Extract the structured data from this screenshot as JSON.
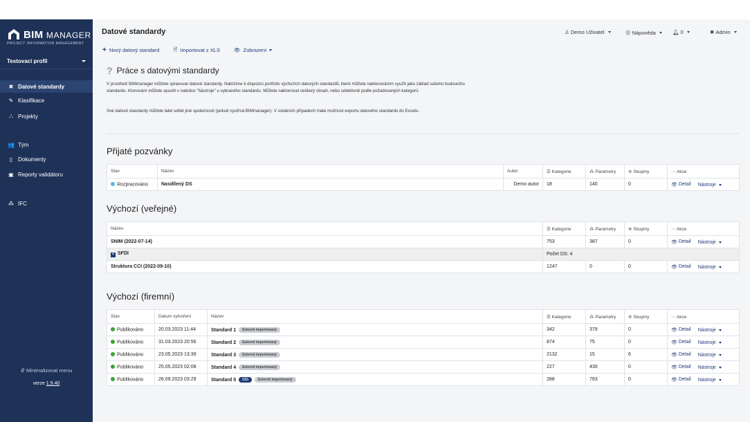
{
  "sidebar": {
    "logo_bold": "BIM",
    "logo_thin": "MANAGER",
    "logo_sub": "PROJECT INFORMATION MANAGEMENT",
    "profile": "Testovací profil",
    "items": [
      {
        "label": "Datové standardy",
        "icon": "tools-icon"
      },
      {
        "label": "Klasifikace",
        "icon": "pen-icon"
      },
      {
        "label": "Projekty",
        "icon": "sitemap-icon"
      },
      {
        "label": "Tým",
        "icon": "users-icon"
      },
      {
        "label": "Dokumenty",
        "icon": "document-icon"
      },
      {
        "label": "Reporty validátoru",
        "icon": "clipboard-icon"
      },
      {
        "label": "IFC",
        "icon": "shapes-icon"
      }
    ],
    "minimize": "Minimalizovat menu",
    "version_label": "verze",
    "version": "1.9.40"
  },
  "header": {
    "title": "Datové standardy",
    "user": "Demo Uživatel",
    "help": "Nápověda",
    "notifications": "0",
    "admin": "Admin"
  },
  "toolbar": {
    "new": "Nový datový standard",
    "import": "Importovat z XLS",
    "view": "Zobrazení"
  },
  "help": {
    "title": "Práce s datovými standardy",
    "p1": "V prostředí BIMmanager můžete spravovat datové standardy. Nabízíme k dispozici portfolio výchozích datových standardů, které můžete naklonováním využít jako základ vašeho budoucího standardu. Klonování můžete spustit v nabídce \"Nástroje\" u vybraného standardu. Můžete naklonovat veškerý obsah, nebo selektivně podle požadovaných kategorií.",
    "p2": "Své datové standardy můžete také sdílet jiné společnosti (pokud využívá BIMmanager). V ostatních případech máte možnost exportu datového standardu do Excelu."
  },
  "invites": {
    "title": "Přijaté pozvánky",
    "headers": {
      "stav": "Stav",
      "nazev": "Název",
      "autor": "Autor",
      "kategorie": "Kategorie",
      "parametry": "Parametry",
      "skupiny": "Skupiny",
      "akce": "Akce"
    },
    "rows": [
      {
        "stav": "Rozpracováno",
        "nazev": "Nasdílený DS",
        "autor": "Demo autor",
        "kategorie": "18",
        "parametry": "140",
        "skupiny": "0"
      }
    ]
  },
  "public": {
    "title": "Výchozí (veřejné)",
    "headers": {
      "nazev": "Název",
      "kategorie": "Kategorie",
      "parametry": "Parametry",
      "skupiny": "Skupiny",
      "akce": "Akce"
    },
    "rows": [
      {
        "nazev": "SNIM (2022-07-14)",
        "kategorie": "753",
        "parametry": "387",
        "skupiny": "0"
      },
      {
        "nazev": "SFDI",
        "count_label": "Počet DS: 4"
      },
      {
        "nazev": "Struktura CCI (2022-09-10)",
        "kategorie": "1247",
        "parametry": "0",
        "skupiny": "0"
      }
    ]
  },
  "company": {
    "title": "Výchozí (firemní)",
    "headers": {
      "stav": "Stav",
      "datum": "Datum vytvoření",
      "nazev": "Název",
      "kategorie": "Kategorie",
      "parametry": "Parametry",
      "skupiny": "Skupiny",
      "akce": "Akce"
    },
    "badge_ext": "Externě importovaný",
    "badge_cci": "CCI",
    "rows": [
      {
        "stav": "Publikováno",
        "datum": "20.03.2023 11:44",
        "nazev": "Standard 1",
        "kategorie": "342",
        "parametry": "379",
        "skupiny": "0"
      },
      {
        "stav": "Publikováno",
        "datum": "31.03.2023 20:56",
        "nazev": "Standard 2",
        "kategorie": "874",
        "parametry": "75",
        "skupiny": "0"
      },
      {
        "stav": "Publikováno",
        "datum": "23.05.2023 13:39",
        "nazev": "Standard 3",
        "kategorie": "2132",
        "parametry": "15",
        "skupiny": "6"
      },
      {
        "stav": "Publikováno",
        "datum": "25.05.2023 02:08",
        "nazev": "Standard 4",
        "kategorie": "227",
        "parametry": "430",
        "skupiny": "0"
      },
      {
        "stav": "Publikováno",
        "datum": "26.09.2023 03:29",
        "nazev": "Standard 5",
        "kategorie": "288",
        "parametry": "763",
        "skupiny": "0"
      }
    ]
  },
  "actions": {
    "detail": "Detail",
    "tools": "Nástroje"
  },
  "colors": {
    "sidebar": "#1e3157",
    "accent": "#1e3a78",
    "published": "#3aa335",
    "in_progress": "#5bb7e0"
  }
}
